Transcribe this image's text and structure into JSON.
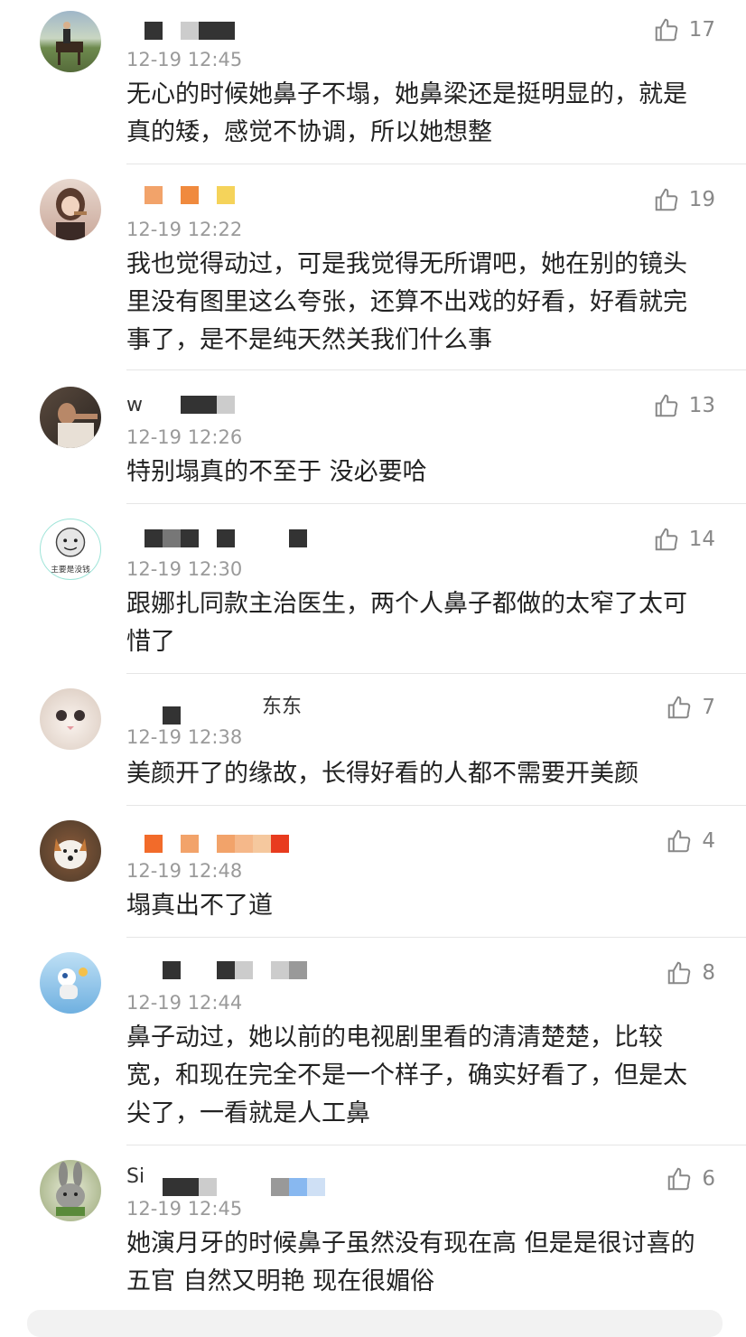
{
  "comments": [
    {
      "username_text": "",
      "time": "12-19 12:45",
      "likes": "17",
      "text": "无心的时候她鼻子不塌，她鼻梁还是挺明显的，就是真的矮，感觉不协调，所以她想整",
      "avatar": "horse-rider-avatar",
      "mosaic": [
        "#333333",
        "#ffffff",
        "#cccccc",
        "#333333",
        "#333333",
        "#ffffff",
        "#ffffff"
      ]
    },
    {
      "username_text": "",
      "time": "12-19 12:22",
      "likes": "19",
      "text": "我也觉得动过，可是我觉得无所谓吧，她在别的镜头里没有图里这么夸张，还算不出戏的好看，好看就完事了，是不是纯天然关我们什么事",
      "avatar": "girl-eating-avatar",
      "mosaic": [
        "#f2a36a",
        "#ffffff",
        "#f08a3e",
        "#ffffff",
        "#f5d35a"
      ]
    },
    {
      "username_text": "w",
      "time": "12-19 12:26",
      "likes": "13",
      "text": "特别塌真的不至于 没必要哈",
      "avatar": "man-portrait-avatar",
      "mosaic": [
        "#333333",
        "#333333",
        "#cccccc"
      ]
    },
    {
      "username_text": "",
      "time": "12-19 12:30",
      "likes": "14",
      "text": "跟娜扎同款主治医生，两个人鼻子都做的太窄了太可惜了",
      "avatar": "meme-face-avatar",
      "avatar_caption": "主要是没钱",
      "mosaic": [
        "#333333",
        "#777777",
        "#333333",
        "#ffffff",
        "#333333",
        "#ffffff",
        "#ffffff",
        "#ffffff",
        "#333333"
      ]
    },
    {
      "username_text": "东东",
      "time": "12-19 12:38",
      "likes": "7",
      "text": "美颜开了的缘故，长得好看的人都不需要开美颜",
      "avatar": "white-cat-avatar",
      "mosaic": [
        "#ffffff",
        "#333333",
        "#ffffff",
        "#ffffff",
        "#ffffff"
      ]
    },
    {
      "username_text": "",
      "time": "12-19 12:48",
      "likes": "4",
      "text": "塌真出不了道",
      "avatar": "shiba-dog-avatar",
      "mosaic": [
        "#f26b2a",
        "#ffffff",
        "#f2a36a",
        "#ffffff",
        "#f2a36a",
        "#f5b88a",
        "#f5c89e",
        "#e83b1e"
      ]
    },
    {
      "username_text": "",
      "time": "12-19 12:44",
      "likes": "8",
      "text": "鼻子动过，她以前的电视剧里看的清清楚楚，比较宽，和现在完全不是一个样子，确实好看了，但是太尖了，一看就是人工鼻",
      "avatar": "cartoon-sky-avatar",
      "mosaic": [
        "#333333",
        "#ffffff",
        "#ffffff",
        "#333333",
        "#cccccc",
        "#ffffff",
        "#cccccc",
        "#999999"
      ]
    },
    {
      "username_text": "Si",
      "time": "12-19 12:45",
      "likes": "6",
      "text": "她演月牙的时候鼻子虽然没有现在高 但是是很讨喜的五官 自然又明艳 现在很媚俗",
      "avatar": "bunny-avatar",
      "mosaic": [
        "#333333",
        "#333333",
        "#cccccc",
        "#ffffff",
        "#ffffff",
        "#ffffff",
        "#999999",
        "#88b8f0",
        "#cfe0f5"
      ]
    }
  ]
}
